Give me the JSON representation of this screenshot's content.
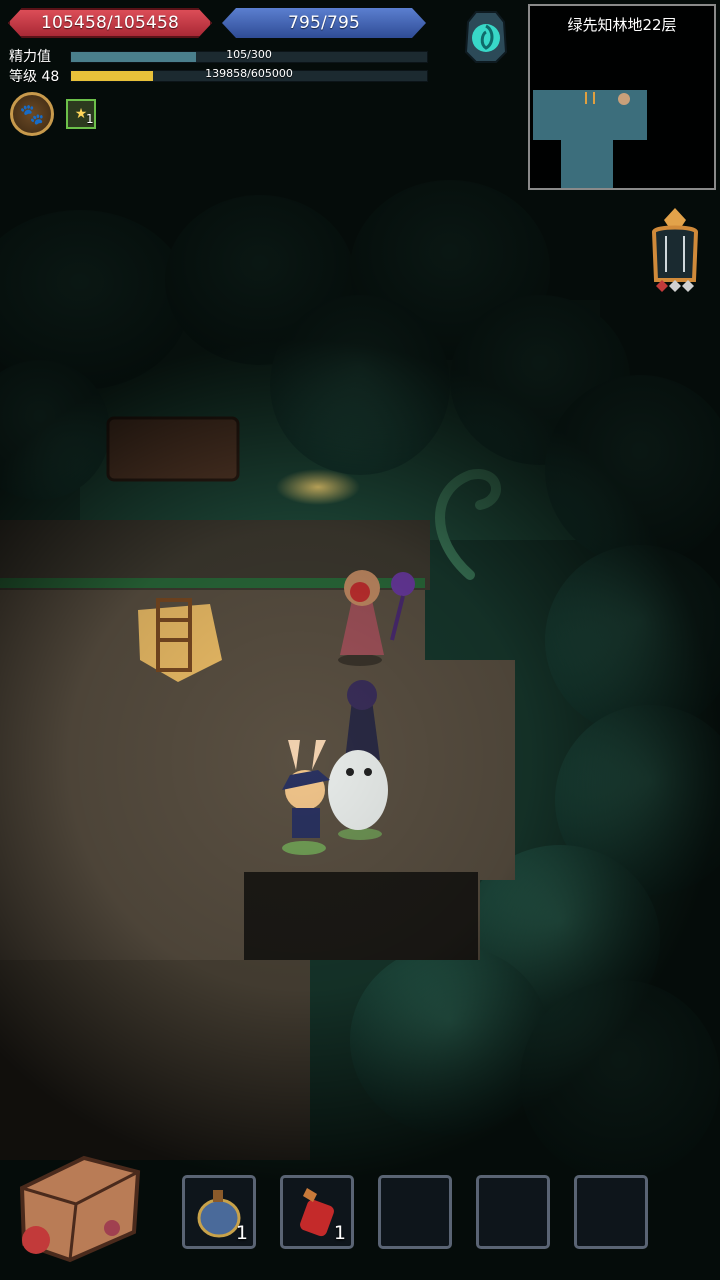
{
  "hud": {
    "hp": "105458/105458",
    "mp": "795/795",
    "energy": {
      "label": "精力值",
      "value": "105/300",
      "current": 105,
      "max": 300
    },
    "level": {
      "label": "等级 48",
      "exp": "139858/605000",
      "current": 139858,
      "max": 605000
    },
    "buff_count": "1"
  },
  "minimap": {
    "title": "绿先知林地22层"
  },
  "inventory": {
    "slots": [
      {
        "item": "blue-potion-icon",
        "qty": "1"
      },
      {
        "item": "red-potion-icon",
        "qty": "1"
      },
      {
        "item": "empty-slot",
        "qty": ""
      },
      {
        "item": "empty-slot",
        "qty": ""
      },
      {
        "item": "empty-slot",
        "qty": ""
      }
    ]
  },
  "colors": {
    "hp": "#c23a45",
    "mp": "#4566b4",
    "energy_fill": "#4a7f8c",
    "exp_fill": "#e8c13a",
    "grass": "#1f4a3a",
    "stone_floor": "#5a5042"
  }
}
